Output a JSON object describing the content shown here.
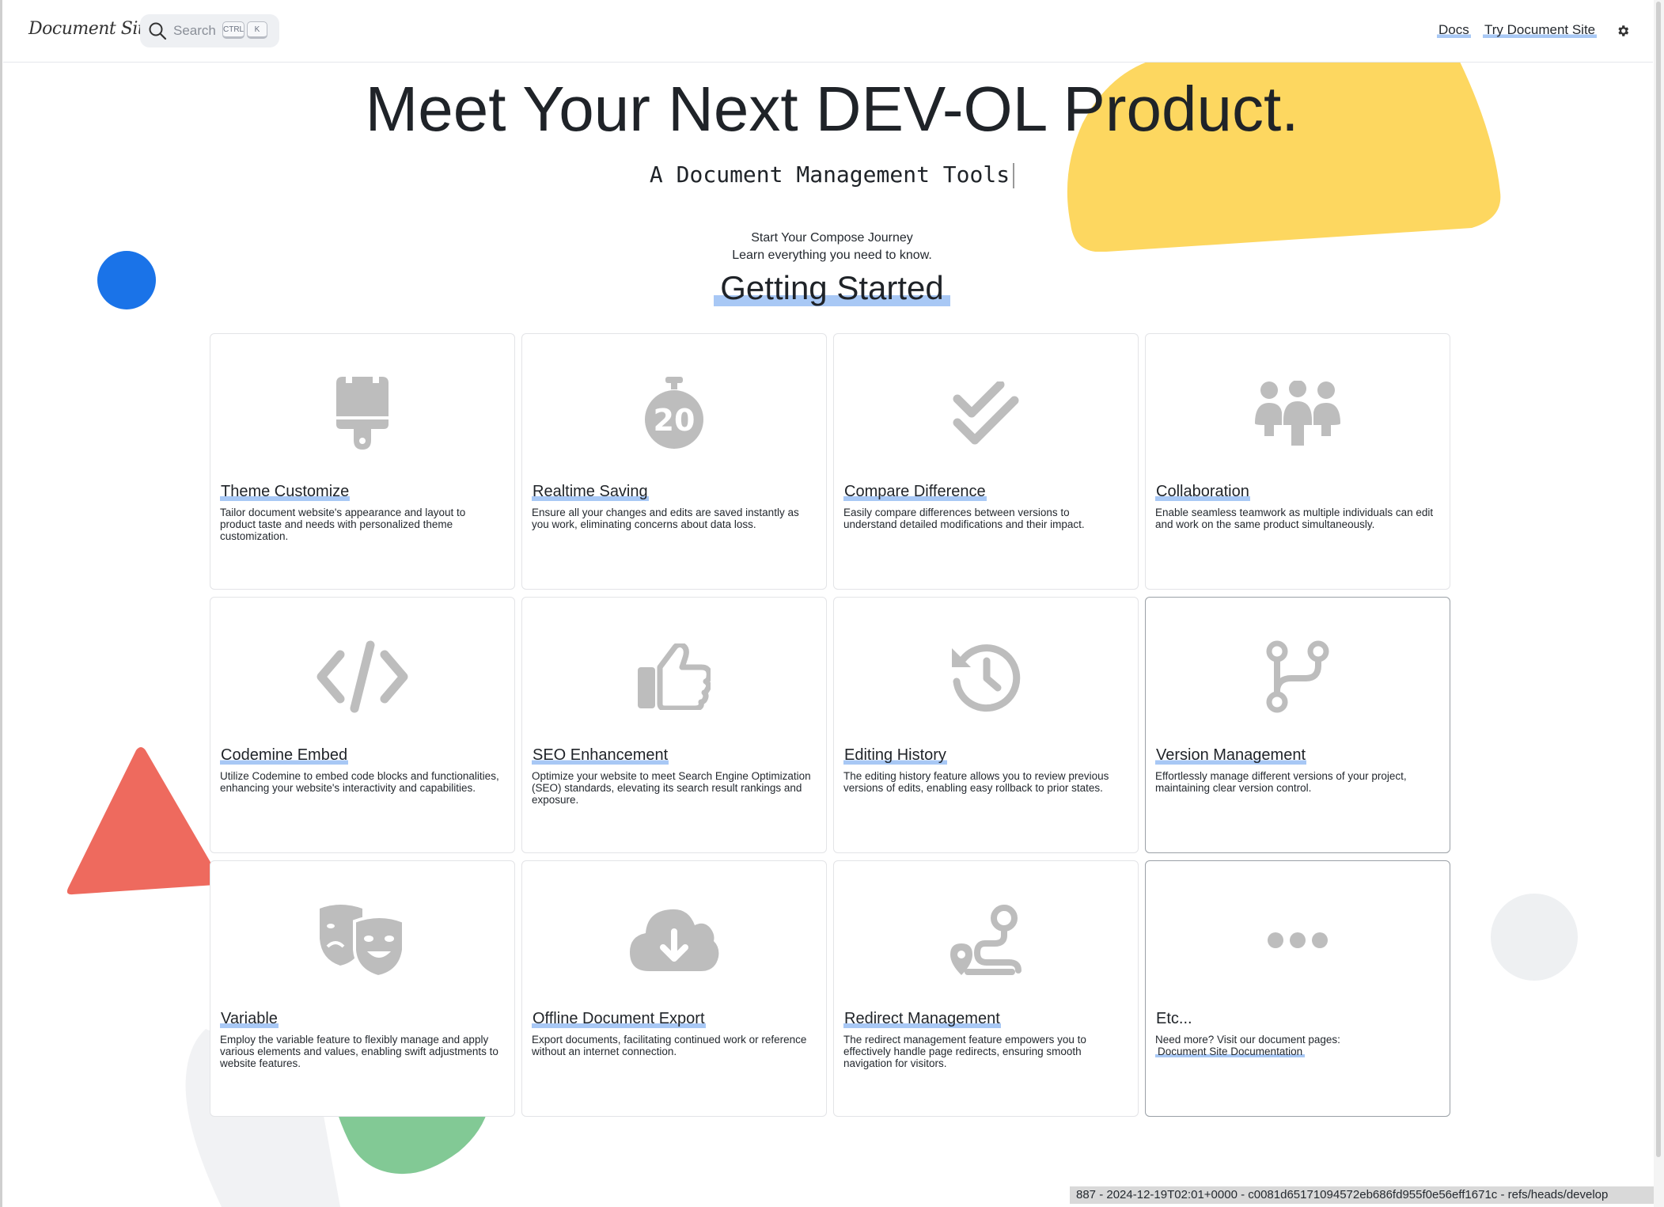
{
  "header": {
    "logo_text": "Document Site",
    "search_placeholder": "Search",
    "kbd_ctrl": "CTRL",
    "kbd_k": "K",
    "nav": [
      {
        "label": "Docs"
      },
      {
        "label": "Try Document Site"
      }
    ]
  },
  "hero": {
    "title": "Meet Your Next DEV-OL Product.",
    "subtitle": "A Document Management Tools",
    "journey_line1": "Start Your Compose Journey",
    "journey_line2": "Learn everything you need to know.",
    "section_title": "Getting Started"
  },
  "cards": [
    {
      "icon": "paintbrush-icon",
      "title": "Theme Customize",
      "desc": "Tailor document website's appearance and layout to product taste and needs with personalized theme customization."
    },
    {
      "icon": "stopwatch-20-icon",
      "title": "Realtime Saving",
      "desc": "Ensure all your changes and edits are saved instantly as you work, eliminating concerns about data loss."
    },
    {
      "icon": "double-check-icon",
      "title": "Compare Difference",
      "desc": "Easily compare differences between versions to understand detailed modifications and their impact."
    },
    {
      "icon": "group-people-icon",
      "title": "Collaboration",
      "desc": "Enable seamless teamwork as multiple individuals can edit and work on the same product simultaneously."
    },
    {
      "icon": "code-icon",
      "title": "Codemine Embed",
      "desc": "Utilize Codemine to embed code blocks and functionalities, enhancing your website's interactivity and capabilities."
    },
    {
      "icon": "thumbs-up-icon",
      "title": "SEO Enhancement",
      "desc": "Optimize your website to meet Search Engine Optimization (SEO) standards, elevating its search result rankings and exposure."
    },
    {
      "icon": "history-icon",
      "title": "Editing History",
      "desc": "The editing history feature allows you to review previous versions of edits, enabling easy rollback to prior states."
    },
    {
      "icon": "code-branch-icon",
      "title": "Version Management",
      "desc": "Effortlessly manage different versions of your project, maintaining clear version control."
    },
    {
      "icon": "theater-masks-icon",
      "title": "Variable",
      "desc": "Employ the variable feature to flexibly manage and apply various elements and values, enabling swift adjustments to website features."
    },
    {
      "icon": "cloud-download-icon",
      "title": "Offline Document Export",
      "desc": "Export documents, facilitating continued work or reference without an internet connection."
    },
    {
      "icon": "route-icon",
      "title": "Redirect Management",
      "desc": "The redirect management feature empowers you to effectively handle page redirects, ensuring smooth navigation for visitors."
    },
    {
      "icon": "ellipsis-icon",
      "title": "Etc...",
      "desc": "Need more? Visit our document pages:",
      "link": "Document Site Documentation"
    }
  ],
  "status_bar": "887 - 2024-12-19T02:01+0000 - c0081d65171094572eb686fd955f0e56eff1671c - refs/heads/develop"
}
